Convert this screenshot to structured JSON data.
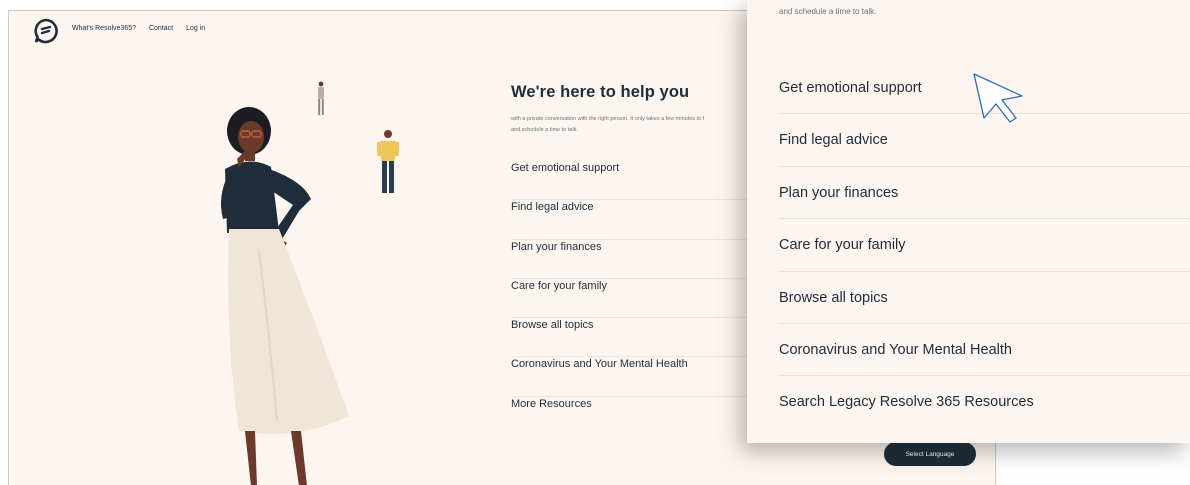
{
  "nav": {
    "links": [
      "What's Resolve365?",
      "Contact",
      "Log in"
    ]
  },
  "help": {
    "title": "We're here to help you",
    "intro_line1": "with a private conversation with the right person. It only takes a few minutes to f",
    "intro_line2": "and schedule a time to talk.",
    "topics": [
      "Get emotional support",
      "Find legal advice",
      "Plan your finances",
      "Care for your family",
      "Browse all topics",
      "Coronavirus and Your Mental Health",
      "More Resources"
    ]
  },
  "language_button": "Select Language",
  "zoom": {
    "intro": "and schedule a time to talk.",
    "topics": [
      "Get emotional support",
      "Find legal advice",
      "Plan your finances",
      "Care for your family",
      "Browse all topics",
      "Coronavirus and Your Mental Health",
      "Search Legacy Resolve 365 Resources"
    ]
  },
  "colors": {
    "page_bg": "#fdf6f0",
    "text": "#1f2d3a",
    "button_bg": "#1a2a36"
  }
}
